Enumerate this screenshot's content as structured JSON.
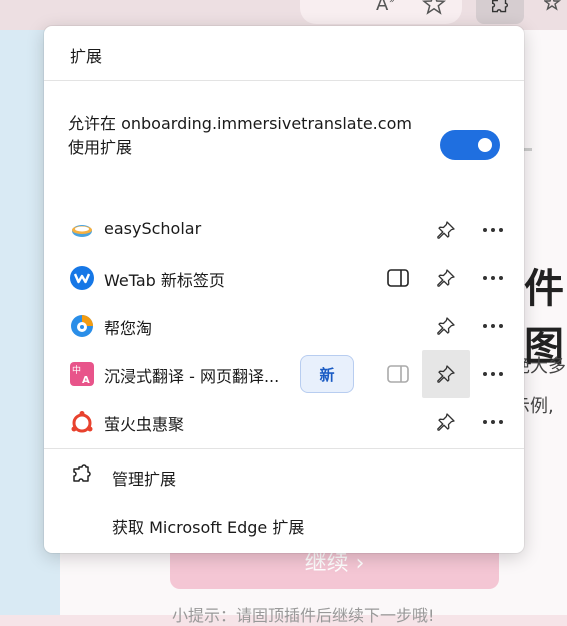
{
  "browser": {
    "toolbar": {
      "read_aloud_icon": "read-aloud-icon",
      "favorite_icon": "star-icon",
      "extensions_icon": "puzzle-icon"
    }
  },
  "background_page": {
    "heading_fragment": "件图",
    "text_fragment_1": "绝大多",
    "text_fragment_2": "示例,",
    "continue_button": "继续 ›",
    "tip_text": "小提示：请固顶插件后继续下一步哦!"
  },
  "popup": {
    "title": "扩展",
    "allow_text": "允许在 onboarding.immersivetranslate.com 使用扩展",
    "allow_toggle": "on",
    "extensions": [
      {
        "name": "easyScholar",
        "icon": "easyscholar-icon",
        "color": "#e88a2a",
        "has_sidebar": false,
        "is_new": false
      },
      {
        "name": "WeTab 新标签页",
        "icon": "wetab-icon",
        "color": "#1677e6",
        "has_sidebar": true,
        "is_new": false
      },
      {
        "name": "帮您淘",
        "icon": "bangnintao-icon",
        "color": "#2a8ee8",
        "has_sidebar": false,
        "is_new": false
      },
      {
        "name": "沉浸式翻译 - 网页翻译...",
        "icon": "immersive-translate-icon",
        "color": "#e8548a",
        "has_sidebar": true,
        "is_new": true,
        "new_label": "新"
      },
      {
        "name": "萤火虫惠聚",
        "icon": "firefly-icon",
        "color": "#e8422e",
        "has_sidebar": false,
        "is_new": false
      }
    ],
    "footer": {
      "manage": "管理扩展",
      "get": "获取 Microsoft Edge 扩展"
    }
  }
}
